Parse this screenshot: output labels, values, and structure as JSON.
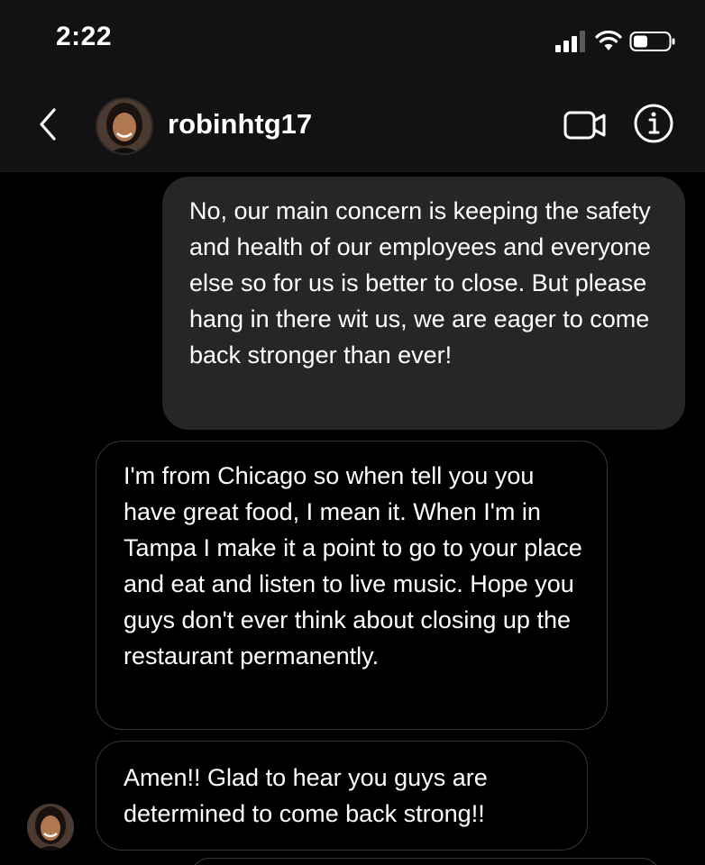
{
  "status_bar": {
    "time": "2:22",
    "signal_icon": "cellular-signal-icon",
    "wifi_icon": "wifi-icon",
    "battery_icon": "battery-icon"
  },
  "header": {
    "back_icon": "chevron-left-icon",
    "username": "robinhtg17",
    "video_icon": "video-call-icon",
    "info_icon": "info-icon"
  },
  "messages": [
    {
      "direction": "outgoing",
      "text": "No, our main concern is keeping the safety and health of our employees and everyone else so for us is better to close. But please hang in there wit us, we are eager to come back stronger than ever!"
    },
    {
      "direction": "incoming",
      "text": "I'm from Chicago so when tell you you have great food, I mean it. When I'm in Tampa I make it a point to go to your place and eat and listen to live music. Hope you guys don't ever think about closing up the restaurant permanently."
    },
    {
      "direction": "incoming",
      "text": "Amen!! Glad to hear you guys are determined to come back strong!!"
    }
  ],
  "colors": {
    "background": "#000000",
    "header_background": "#121212",
    "outgoing_bubble": "#262626",
    "incoming_border": "#363636",
    "text": "#ffffff"
  }
}
